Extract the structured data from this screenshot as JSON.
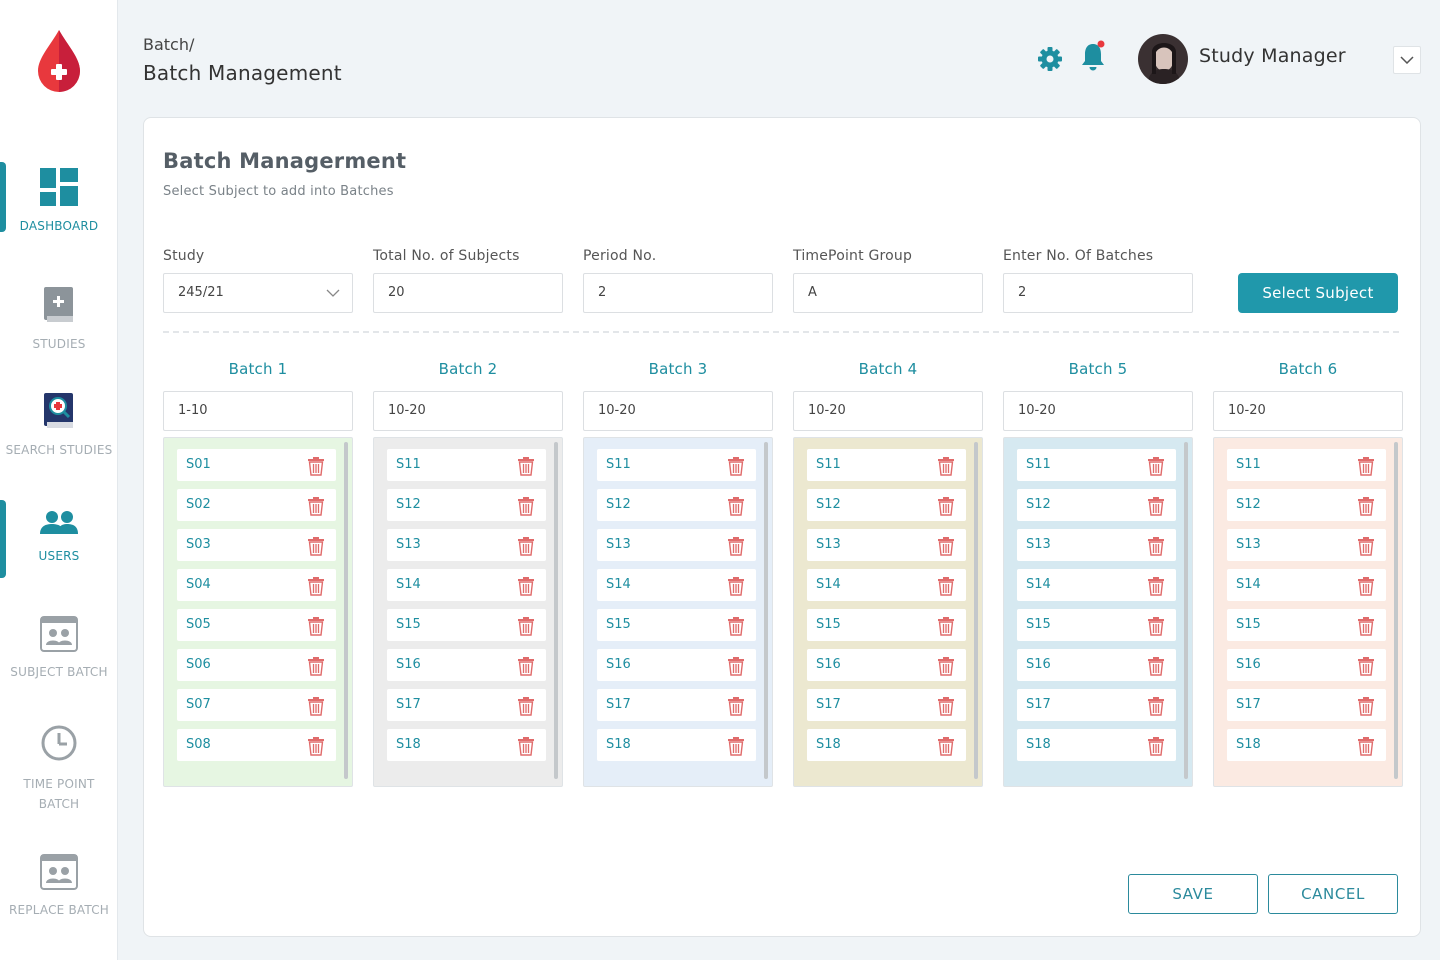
{
  "sidebar": {
    "items": [
      {
        "label": "DASHBOARD",
        "icon": "dashboard-icon",
        "active": true
      },
      {
        "label": "STUDIES",
        "icon": "book-icon",
        "active": false
      },
      {
        "label": "SEARCH STUDIES",
        "icon": "search-book-icon",
        "active": false
      },
      {
        "label": "USERS",
        "icon": "users-icon",
        "active": true
      },
      {
        "label": "SUBJECT BATCH",
        "icon": "id-card-icon",
        "active": false
      },
      {
        "label": "TIME POINT",
        "label2": "BATCH",
        "icon": "clock-icon",
        "active": false
      },
      {
        "label": "REPLACE BATCH",
        "icon": "id-card-icon",
        "active": false
      }
    ]
  },
  "header": {
    "breadcrumb": "Batch/",
    "title": "Batch Management",
    "user_name": "Study Manager"
  },
  "card": {
    "title": "Batch Managerment",
    "subtitle": "Select Subject to add into Batches",
    "fields": [
      {
        "label": "Study",
        "value": "245/21",
        "dropdown": true
      },
      {
        "label": "Total No. of Subjects",
        "value": "20"
      },
      {
        "label": "Period No.",
        "value": "2"
      },
      {
        "label": "TimePoint Group",
        "value": "A"
      },
      {
        "label": "Enter No. Of Batches",
        "value": "2"
      }
    ],
    "select_button": "Select Subject",
    "save_button": "SAVE",
    "cancel_button": "CANCEL"
  },
  "batches": [
    {
      "title": "Batch 1",
      "range": "1-10",
      "color": "#e6f6e2",
      "subjects": [
        "S01",
        "S02",
        "S03",
        "S04",
        "S05",
        "S06",
        "S07",
        "S08"
      ]
    },
    {
      "title": "Batch 2",
      "range": "10-20",
      "color": "#ececec",
      "subjects": [
        "S11",
        "S12",
        "S13",
        "S14",
        "S15",
        "S16",
        "S17",
        "S18"
      ]
    },
    {
      "title": "Batch 3",
      "range": "10-20",
      "color": "#e5eef8",
      "subjects": [
        "S11",
        "S12",
        "S13",
        "S14",
        "S15",
        "S16",
        "S17",
        "S18"
      ]
    },
    {
      "title": "Batch 4",
      "range": "10-20",
      "color": "#ece8d0",
      "subjects": [
        "S11",
        "S12",
        "S13",
        "S14",
        "S15",
        "S16",
        "S17",
        "S18"
      ]
    },
    {
      "title": "Batch 5",
      "range": "10-20",
      "color": "#d6e9f1",
      "subjects": [
        "S11",
        "S12",
        "S13",
        "S14",
        "S15",
        "S16",
        "S17",
        "S18"
      ]
    },
    {
      "title": "Batch 6",
      "range": "10-20",
      "color": "#fbeae2",
      "subjects": [
        "S11",
        "S12",
        "S13",
        "S14",
        "S15",
        "S16",
        "S17",
        "S18"
      ]
    }
  ],
  "colors": {
    "accent": "#1e8ea0",
    "button": "#2098ab",
    "trash": "#e06b6b",
    "logo": "#e8383d"
  }
}
